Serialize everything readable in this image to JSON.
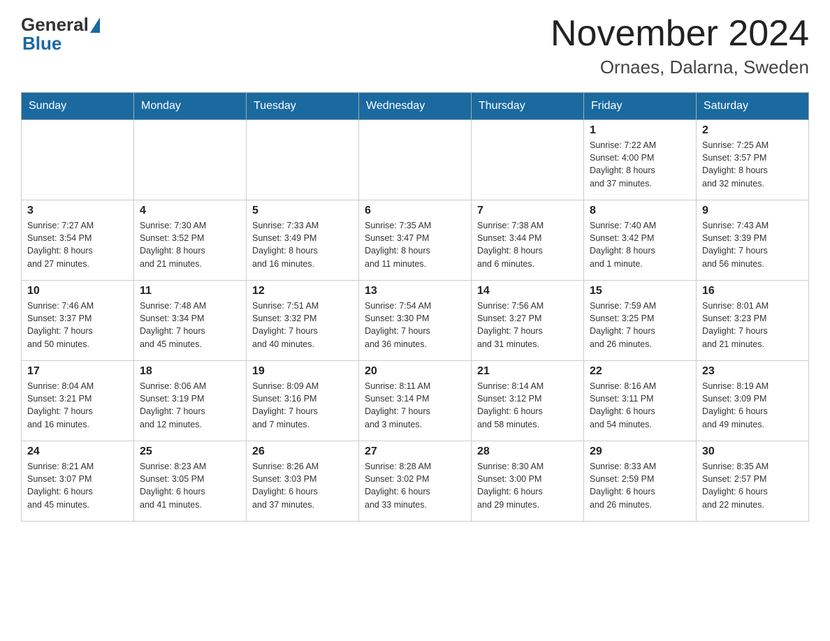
{
  "header": {
    "logo_general": "General",
    "logo_blue": "Blue",
    "title": "November 2024",
    "subtitle": "Ornaes, Dalarna, Sweden"
  },
  "weekdays": [
    "Sunday",
    "Monday",
    "Tuesday",
    "Wednesday",
    "Thursday",
    "Friday",
    "Saturday"
  ],
  "weeks": [
    {
      "days": [
        {
          "num": "",
          "info": ""
        },
        {
          "num": "",
          "info": ""
        },
        {
          "num": "",
          "info": ""
        },
        {
          "num": "",
          "info": ""
        },
        {
          "num": "",
          "info": ""
        },
        {
          "num": "1",
          "info": "Sunrise: 7:22 AM\nSunset: 4:00 PM\nDaylight: 8 hours\nand 37 minutes."
        },
        {
          "num": "2",
          "info": "Sunrise: 7:25 AM\nSunset: 3:57 PM\nDaylight: 8 hours\nand 32 minutes."
        }
      ]
    },
    {
      "days": [
        {
          "num": "3",
          "info": "Sunrise: 7:27 AM\nSunset: 3:54 PM\nDaylight: 8 hours\nand 27 minutes."
        },
        {
          "num": "4",
          "info": "Sunrise: 7:30 AM\nSunset: 3:52 PM\nDaylight: 8 hours\nand 21 minutes."
        },
        {
          "num": "5",
          "info": "Sunrise: 7:33 AM\nSunset: 3:49 PM\nDaylight: 8 hours\nand 16 minutes."
        },
        {
          "num": "6",
          "info": "Sunrise: 7:35 AM\nSunset: 3:47 PM\nDaylight: 8 hours\nand 11 minutes."
        },
        {
          "num": "7",
          "info": "Sunrise: 7:38 AM\nSunset: 3:44 PM\nDaylight: 8 hours\nand 6 minutes."
        },
        {
          "num": "8",
          "info": "Sunrise: 7:40 AM\nSunset: 3:42 PM\nDaylight: 8 hours\nand 1 minute."
        },
        {
          "num": "9",
          "info": "Sunrise: 7:43 AM\nSunset: 3:39 PM\nDaylight: 7 hours\nand 56 minutes."
        }
      ]
    },
    {
      "days": [
        {
          "num": "10",
          "info": "Sunrise: 7:46 AM\nSunset: 3:37 PM\nDaylight: 7 hours\nand 50 minutes."
        },
        {
          "num": "11",
          "info": "Sunrise: 7:48 AM\nSunset: 3:34 PM\nDaylight: 7 hours\nand 45 minutes."
        },
        {
          "num": "12",
          "info": "Sunrise: 7:51 AM\nSunset: 3:32 PM\nDaylight: 7 hours\nand 40 minutes."
        },
        {
          "num": "13",
          "info": "Sunrise: 7:54 AM\nSunset: 3:30 PM\nDaylight: 7 hours\nand 36 minutes."
        },
        {
          "num": "14",
          "info": "Sunrise: 7:56 AM\nSunset: 3:27 PM\nDaylight: 7 hours\nand 31 minutes."
        },
        {
          "num": "15",
          "info": "Sunrise: 7:59 AM\nSunset: 3:25 PM\nDaylight: 7 hours\nand 26 minutes."
        },
        {
          "num": "16",
          "info": "Sunrise: 8:01 AM\nSunset: 3:23 PM\nDaylight: 7 hours\nand 21 minutes."
        }
      ]
    },
    {
      "days": [
        {
          "num": "17",
          "info": "Sunrise: 8:04 AM\nSunset: 3:21 PM\nDaylight: 7 hours\nand 16 minutes."
        },
        {
          "num": "18",
          "info": "Sunrise: 8:06 AM\nSunset: 3:19 PM\nDaylight: 7 hours\nand 12 minutes."
        },
        {
          "num": "19",
          "info": "Sunrise: 8:09 AM\nSunset: 3:16 PM\nDaylight: 7 hours\nand 7 minutes."
        },
        {
          "num": "20",
          "info": "Sunrise: 8:11 AM\nSunset: 3:14 PM\nDaylight: 7 hours\nand 3 minutes."
        },
        {
          "num": "21",
          "info": "Sunrise: 8:14 AM\nSunset: 3:12 PM\nDaylight: 6 hours\nand 58 minutes."
        },
        {
          "num": "22",
          "info": "Sunrise: 8:16 AM\nSunset: 3:11 PM\nDaylight: 6 hours\nand 54 minutes."
        },
        {
          "num": "23",
          "info": "Sunrise: 8:19 AM\nSunset: 3:09 PM\nDaylight: 6 hours\nand 49 minutes."
        }
      ]
    },
    {
      "days": [
        {
          "num": "24",
          "info": "Sunrise: 8:21 AM\nSunset: 3:07 PM\nDaylight: 6 hours\nand 45 minutes."
        },
        {
          "num": "25",
          "info": "Sunrise: 8:23 AM\nSunset: 3:05 PM\nDaylight: 6 hours\nand 41 minutes."
        },
        {
          "num": "26",
          "info": "Sunrise: 8:26 AM\nSunset: 3:03 PM\nDaylight: 6 hours\nand 37 minutes."
        },
        {
          "num": "27",
          "info": "Sunrise: 8:28 AM\nSunset: 3:02 PM\nDaylight: 6 hours\nand 33 minutes."
        },
        {
          "num": "28",
          "info": "Sunrise: 8:30 AM\nSunset: 3:00 PM\nDaylight: 6 hours\nand 29 minutes."
        },
        {
          "num": "29",
          "info": "Sunrise: 8:33 AM\nSunset: 2:59 PM\nDaylight: 6 hours\nand 26 minutes."
        },
        {
          "num": "30",
          "info": "Sunrise: 8:35 AM\nSunset: 2:57 PM\nDaylight: 6 hours\nand 22 minutes."
        }
      ]
    }
  ]
}
